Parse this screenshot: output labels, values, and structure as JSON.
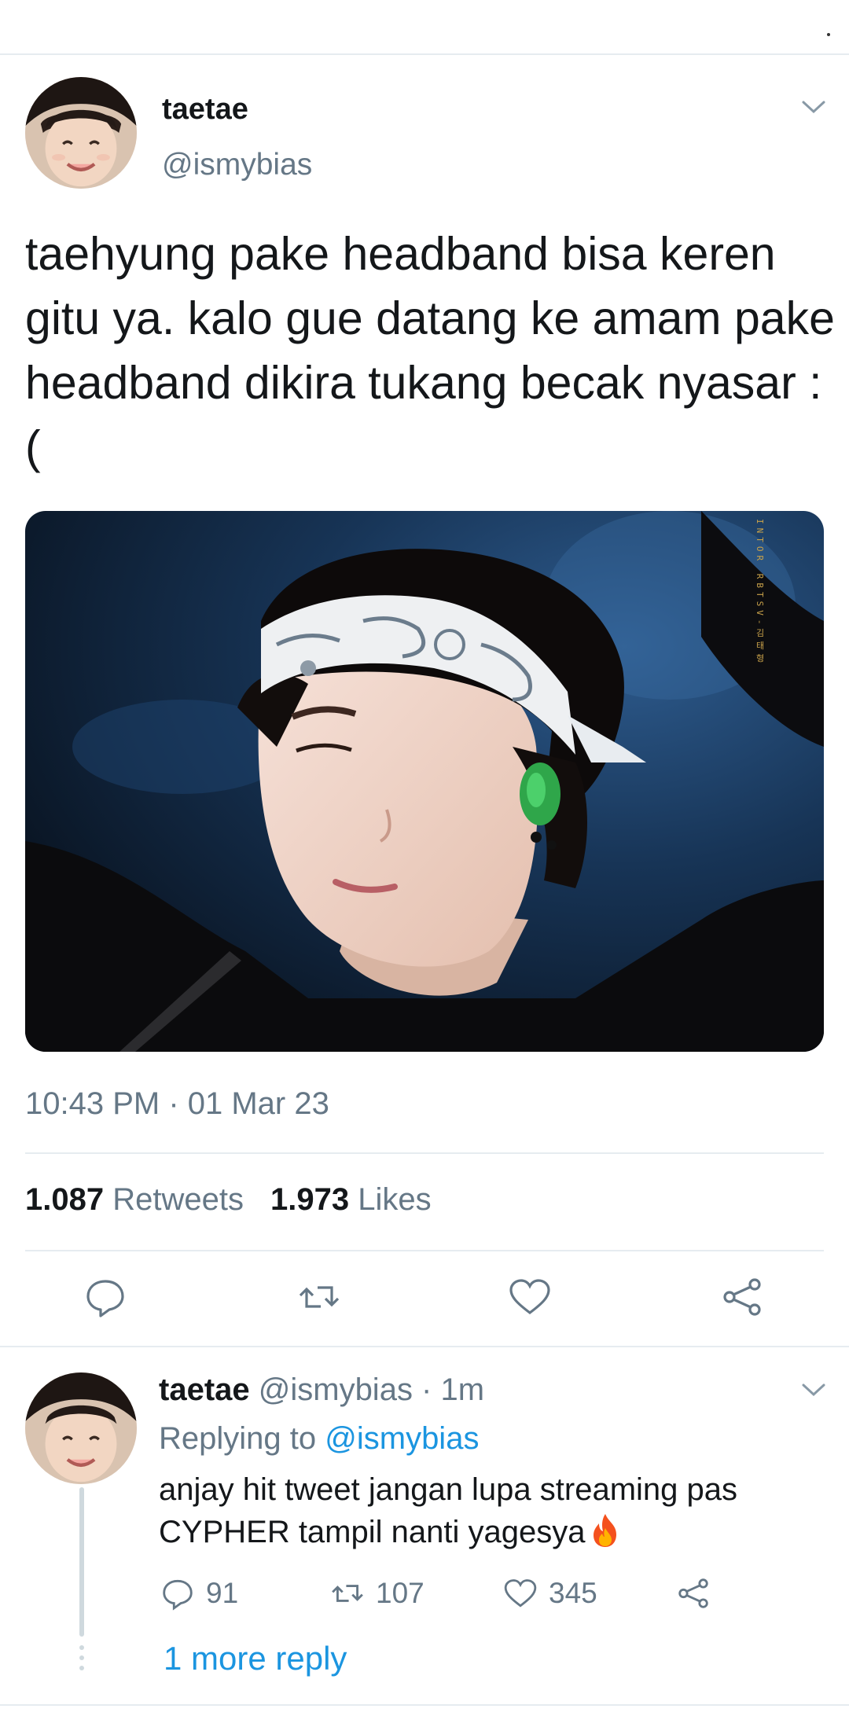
{
  "tweet": {
    "display_name": "taetae",
    "handle": "@ismybias",
    "text": "taehyung pake headband bisa keren gitu ya. kalo gue datang ke amam pake headband dikira tukang becak nyasar :(",
    "timestamp": "10:43 PM · 01 Mar 23",
    "retweets_count": "1.087",
    "retweets_label": "Retweets",
    "likes_count": "1.973",
    "likes_label": "Likes",
    "watermark": "INTOR RBTSV-김태형"
  },
  "actions": {
    "icons": [
      "reply-icon",
      "retweet-icon",
      "like-icon",
      "share-icon"
    ]
  },
  "reply": {
    "display_name": "taetae",
    "handle_time": "@ismybias · 1m",
    "replying_prefix": "Replying to",
    "replying_mention": "@ismybias",
    "text": "anjay hit tweet jangan lupa streaming pas CYPHER tampil nanti yagesya",
    "reply_count": "91",
    "retweet_count": "107",
    "like_count": "345",
    "more_replies": "1 more reply"
  },
  "colors": {
    "primary_text": "#14171a",
    "secondary_text": "#657786",
    "link": "#1b95e0",
    "divider": "#e6ecf0"
  }
}
